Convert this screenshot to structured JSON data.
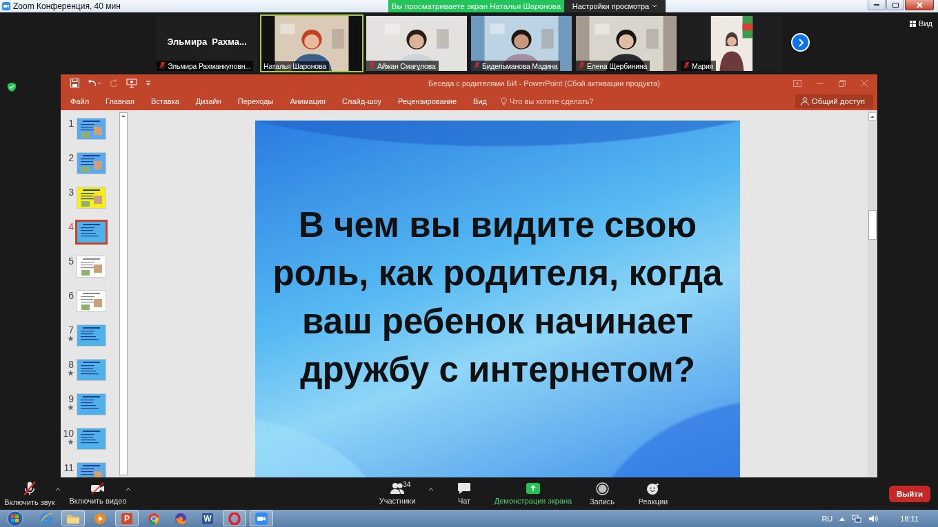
{
  "zoom_window": {
    "title": "Zoom Конференция, 40 мин"
  },
  "share_banner": "Вы просматриваете экран Наталья Шаронова",
  "view_settings": "Настройки просмотра",
  "view_button": "Вид",
  "participants": [
    {
      "kind": "name",
      "display_name": "Эльмира  Рахма...",
      "caption": "Эльмира Рахманкуловн...",
      "muted": true,
      "speaking": false
    },
    {
      "kind": "video",
      "caption": "Наталья Шаронова",
      "muted": false,
      "speaking": true
    },
    {
      "kind": "video",
      "caption": "Айжан Смағұлова",
      "muted": true,
      "speaking": false
    },
    {
      "kind": "video",
      "caption": "Бидельманова Мадина",
      "muted": true,
      "speaking": false
    },
    {
      "kind": "video",
      "caption": "Елена Щербинина",
      "muted": true,
      "speaking": false
    },
    {
      "kind": "portrait",
      "caption": "Мария",
      "muted": true,
      "speaking": false
    }
  ],
  "powerpoint": {
    "title": "Беседа с родителями БИ - PowerPoint (Сбой активации продукта)",
    "tabs": [
      "Файл",
      "Главная",
      "Вставка",
      "Дизайн",
      "Переходы",
      "Анимация",
      "Слайд-шоу",
      "Рецензирование",
      "Вид"
    ],
    "search_hint": "Что вы хотите сделать?",
    "share": "Общий доступ",
    "slides": [
      {
        "number": "1",
        "selected": false,
        "animated": false
      },
      {
        "number": "2",
        "selected": false,
        "animated": false
      },
      {
        "number": "3",
        "kind": "yellow",
        "selected": false,
        "animated": false
      },
      {
        "number": "4",
        "kind": "blue",
        "selected": true,
        "animated": false
      },
      {
        "number": "5",
        "kind": "white",
        "selected": false,
        "animated": false
      },
      {
        "number": "6",
        "kind": "white",
        "selected": false,
        "animated": false
      },
      {
        "number": "7",
        "kind": "blue",
        "selected": false,
        "animated": true
      },
      {
        "number": "8",
        "kind": "blue",
        "selected": false,
        "animated": true
      },
      {
        "number": "9",
        "kind": "blue",
        "selected": false,
        "animated": true
      },
      {
        "number": "10",
        "kind": "blue",
        "selected": false,
        "animated": true
      },
      {
        "number": "11",
        "selected": false,
        "animated": false
      }
    ],
    "slide_text": "В чем вы видите свою роль, как родителя, когда ваш ребенок начинает дружбу с интернетом?"
  },
  "toolbar": [
    {
      "kind": "audio",
      "label": "Включить звук"
    },
    {
      "kind": "video",
      "label": "Включить видео"
    },
    {
      "kind": "participants",
      "label": "Участники",
      "count": "34"
    },
    {
      "kind": "chat",
      "label": "Чат"
    },
    {
      "kind": "share",
      "label": "Демонстрация экрана"
    },
    {
      "kind": "record",
      "label": "Запись"
    },
    {
      "kind": "reactions",
      "label": "Реакции"
    }
  ],
  "leave_button": "Выйти",
  "taskbar": {
    "apps": [
      {
        "kind": "ie",
        "open": false
      },
      {
        "kind": "explorer",
        "open": true
      },
      {
        "kind": "media",
        "open": false
      },
      {
        "kind": "powerpoint",
        "glyph": "P",
        "open": true
      },
      {
        "kind": "chrome",
        "open": false
      },
      {
        "kind": "firefox",
        "open": false
      },
      {
        "kind": "word",
        "glyph": "W",
        "open": false
      },
      {
        "kind": "opera",
        "open": true
      },
      {
        "kind": "zoom",
        "open": true
      }
    ],
    "language": "RU",
    "time": "18:11"
  }
}
